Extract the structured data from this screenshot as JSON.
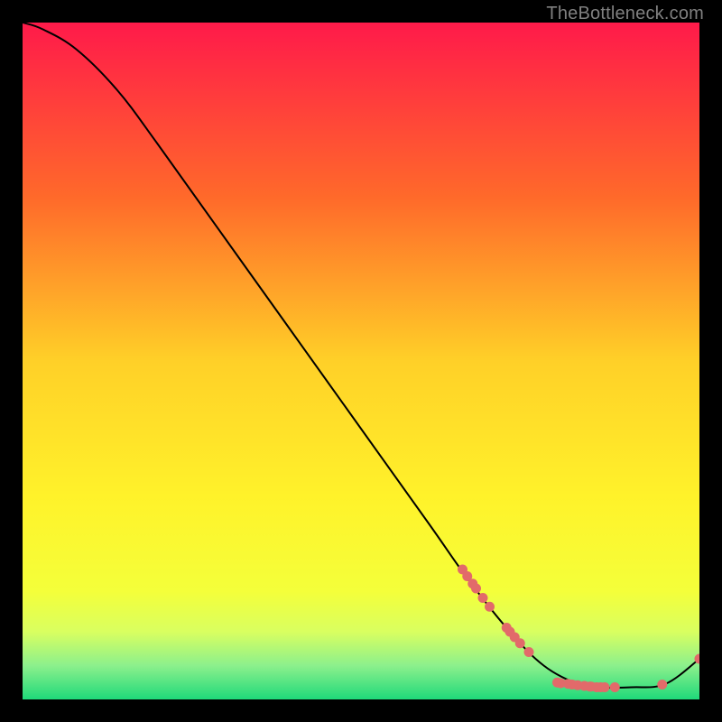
{
  "watermark": "TheBottleneck.com",
  "chart_data": {
    "type": "line",
    "title": "",
    "xlabel": "",
    "ylabel": "",
    "xlim": [
      0,
      100
    ],
    "ylim": [
      0,
      100
    ],
    "background_gradient": {
      "top": "#ff1a4a",
      "upper_mid": "#ff7a2a",
      "mid": "#ffd028",
      "lower_mid": "#f4ff3a",
      "band": "#d9ff60",
      "bottom": "#1fd97a"
    },
    "curve": [
      {
        "x": 0,
        "y": 100
      },
      {
        "x": 3,
        "y": 99
      },
      {
        "x": 8,
        "y": 96
      },
      {
        "x": 14,
        "y": 90
      },
      {
        "x": 20,
        "y": 82
      },
      {
        "x": 30,
        "y": 68
      },
      {
        "x": 40,
        "y": 54
      },
      {
        "x": 50,
        "y": 40
      },
      {
        "x": 60,
        "y": 26
      },
      {
        "x": 66,
        "y": 17.5
      },
      {
        "x": 72,
        "y": 10
      },
      {
        "x": 77,
        "y": 5
      },
      {
        "x": 82,
        "y": 2.3
      },
      {
        "x": 85,
        "y": 1.8
      },
      {
        "x": 90,
        "y": 1.8
      },
      {
        "x": 95,
        "y": 2.3
      },
      {
        "x": 100,
        "y": 6
      }
    ],
    "markers": [
      {
        "x": 65,
        "y": 19.2
      },
      {
        "x": 65.7,
        "y": 18.2
      },
      {
        "x": 66.5,
        "y": 17.1
      },
      {
        "x": 67.0,
        "y": 16.4
      },
      {
        "x": 68.0,
        "y": 15.0
      },
      {
        "x": 69.0,
        "y": 13.7
      },
      {
        "x": 71.5,
        "y": 10.6
      },
      {
        "x": 72.0,
        "y": 10.0
      },
      {
        "x": 72.7,
        "y": 9.2
      },
      {
        "x": 73.5,
        "y": 8.3
      },
      {
        "x": 74.8,
        "y": 7.0
      },
      {
        "x": 79.0,
        "y": 2.5
      },
      {
        "x": 79.5,
        "y": 2.4
      },
      {
        "x": 80.6,
        "y": 2.3
      },
      {
        "x": 81.2,
        "y": 2.2
      },
      {
        "x": 82.0,
        "y": 2.1
      },
      {
        "x": 83.0,
        "y": 2.0
      },
      {
        "x": 83.8,
        "y": 1.9
      },
      {
        "x": 84.0,
        "y": 1.9
      },
      {
        "x": 84.8,
        "y": 1.8
      },
      {
        "x": 85.4,
        "y": 1.8
      },
      {
        "x": 86.0,
        "y": 1.8
      },
      {
        "x": 87.5,
        "y": 1.8
      },
      {
        "x": 94.5,
        "y": 2.2
      },
      {
        "x": 100,
        "y": 6
      }
    ]
  }
}
